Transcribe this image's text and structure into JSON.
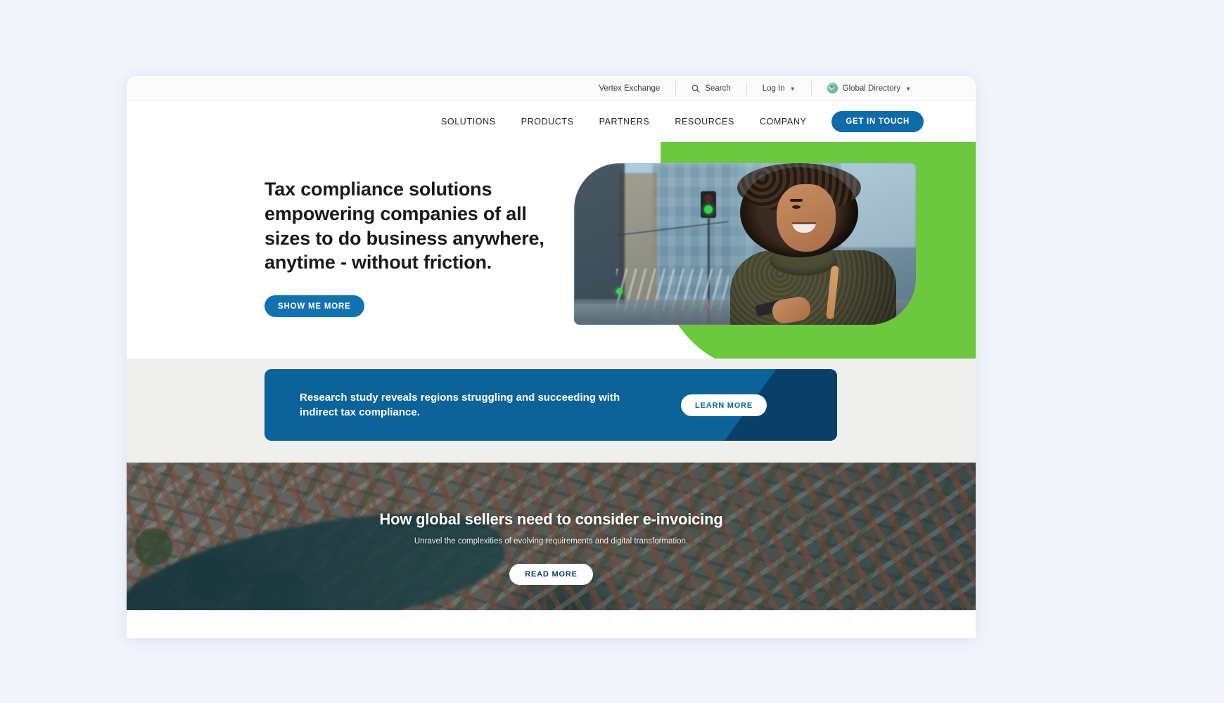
{
  "theme": {
    "page_background": "#f1f4fb",
    "accent_blue": "#0f6ba8",
    "accent_green": "#6cc93f",
    "banner_blue": "#0c6399",
    "banner_wedge_blue": "#0a3f69",
    "band_gray": "#efefed"
  },
  "utility_bar": {
    "vertex_exchange": "Vertex Exchange",
    "search": "Search",
    "search_icon": "search-icon",
    "login": "Log In",
    "login_chevron": "chevron-down-icon",
    "global_directory": "Global Directory",
    "globe_icon": "globe-icon",
    "directory_chevron": "chevron-down-icon"
  },
  "main_nav": {
    "items": [
      {
        "label": "SOLUTIONS"
      },
      {
        "label": "PRODUCTS"
      },
      {
        "label": "PARTNERS"
      },
      {
        "label": "RESOURCES"
      },
      {
        "label": "COMPANY"
      }
    ],
    "cta_label": "GET IN TOUCH"
  },
  "hero": {
    "headline": "Tax compliance solutions empowering companies of all sizes to do business anywhere, anytime - without friction.",
    "cta_label": "SHOW ME MORE",
    "image_alt": "smiling-woman-with-phone-in-city-photo"
  },
  "research_banner": {
    "headline": "Research study reveals regions struggling and succeeding with indirect tax compliance.",
    "cta_label": "LEARN MORE"
  },
  "aerial_section": {
    "headline": "How global sellers need to consider e-invoicing",
    "subtitle": "Unravel the complexities of evolving requirements and digital transformation.",
    "cta_label": "READ MORE",
    "image_alt": "aerial-view-of-riverside-town-photo"
  }
}
